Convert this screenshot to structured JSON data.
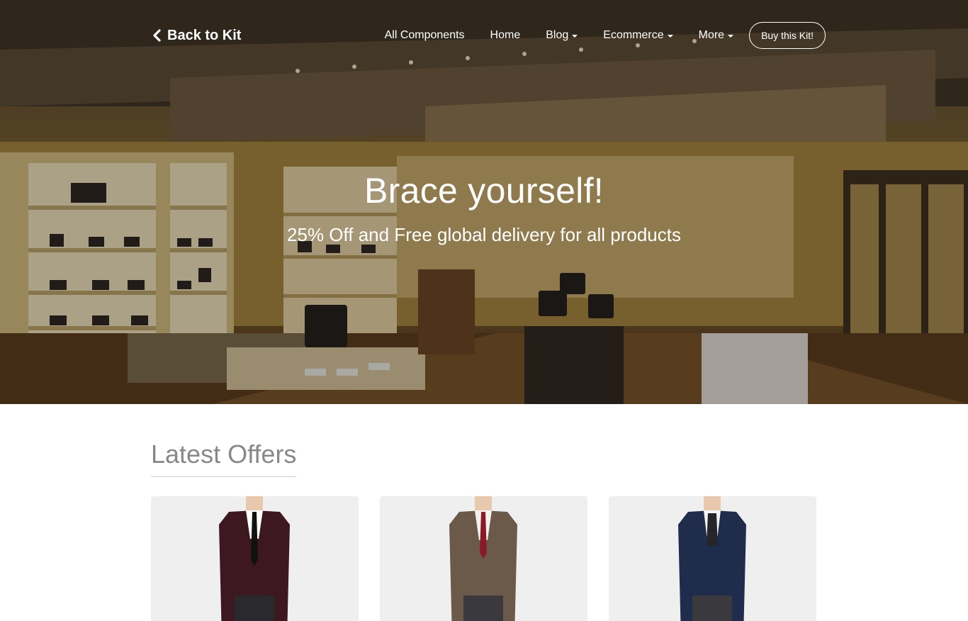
{
  "navbar": {
    "brand_label": "Back to Kit",
    "links": [
      {
        "label": "All Components",
        "dropdown": false
      },
      {
        "label": "Home",
        "dropdown": false
      },
      {
        "label": "Blog",
        "dropdown": true
      },
      {
        "label": "Ecommerce",
        "dropdown": true
      },
      {
        "label": "More",
        "dropdown": true
      }
    ],
    "cta_label": "Buy this Kit!"
  },
  "hero": {
    "title": "Brace yourself!",
    "subtitle": "25% Off and Free global delivery for all products"
  },
  "offers": {
    "section_title": "Latest Offers",
    "products": [
      {
        "jacket_color": "#3d1820",
        "tie_color": "#111111",
        "shirt_color": "#ffffff"
      },
      {
        "jacket_color": "#6b5a4a",
        "tie_color": "#8a1a25",
        "shirt_color": "#f3f0ee"
      },
      {
        "jacket_color": "#1f2c4c",
        "tie_color": "#26262a",
        "shirt_color": "#f4f4f4"
      }
    ]
  },
  "colors": {
    "hero_text": "#ffffff",
    "section_title": "#888888",
    "card_bg": "#efefef"
  }
}
